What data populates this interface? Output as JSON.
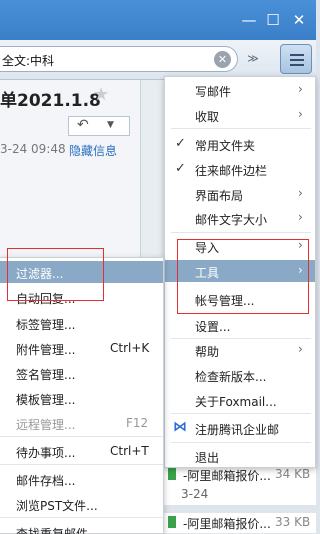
{
  "window": {
    "min": "—",
    "max": "☐",
    "close": "✕"
  },
  "search": {
    "value": "全文:中科",
    "clear": "✕",
    "dropdown": "≫"
  },
  "mail": {
    "subject": "单2021.1.8",
    "star": "★",
    "reply": "↶",
    "reply_menu": "▼",
    "date": "3-24 09:48",
    "hide_info": "隐藏信息"
  },
  "list": [
    {
      "subject": "-阿里邮箱报价...",
      "size": "34 KB",
      "date": "3-24"
    },
    {
      "subject": "-阿里邮箱报价...",
      "size": "33 KB"
    }
  ],
  "main_menu": {
    "items": [
      {
        "label": "写邮件",
        "arrow": "›"
      },
      {
        "label": "收取",
        "arrow": "›"
      },
      {
        "label": "常用文件夹",
        "check": "✓"
      },
      {
        "label": "往来邮件边栏",
        "check": "✓"
      },
      {
        "label": "界面布局",
        "arrow": "›"
      },
      {
        "label": "邮件文字大小",
        "arrow": "›"
      },
      {
        "label": "导入",
        "arrow": "›"
      },
      {
        "label": "工具",
        "arrow": "›"
      },
      {
        "label": "帐号管理..."
      },
      {
        "label": "设置..."
      },
      {
        "label": "帮助",
        "arrow": "›"
      },
      {
        "label": "检查新版本..."
      },
      {
        "label": "关于Foxmail..."
      },
      {
        "label": "注册腾讯企业邮",
        "icon": "⋈"
      },
      {
        "label": "退出"
      }
    ]
  },
  "sub_menu": {
    "items": [
      {
        "label": "过滤器..."
      },
      {
        "label": "自动回复..."
      },
      {
        "label": "标签管理..."
      },
      {
        "label": "附件管理...",
        "shortcut": "Ctrl+K"
      },
      {
        "label": "签名管理..."
      },
      {
        "label": "模板管理..."
      },
      {
        "label": "远程管理...",
        "shortcut": "F12"
      },
      {
        "label": "待办事项...",
        "shortcut": "Ctrl+T"
      },
      {
        "label": "邮件存档..."
      },
      {
        "label": "浏览PST文件..."
      },
      {
        "label": "查找重复邮件"
      }
    ]
  },
  "colors": {
    "highlight": "#8aa9c7",
    "annotation": "#e23030",
    "titlebar": "#3a7fc8",
    "link": "#2a6ebf"
  }
}
